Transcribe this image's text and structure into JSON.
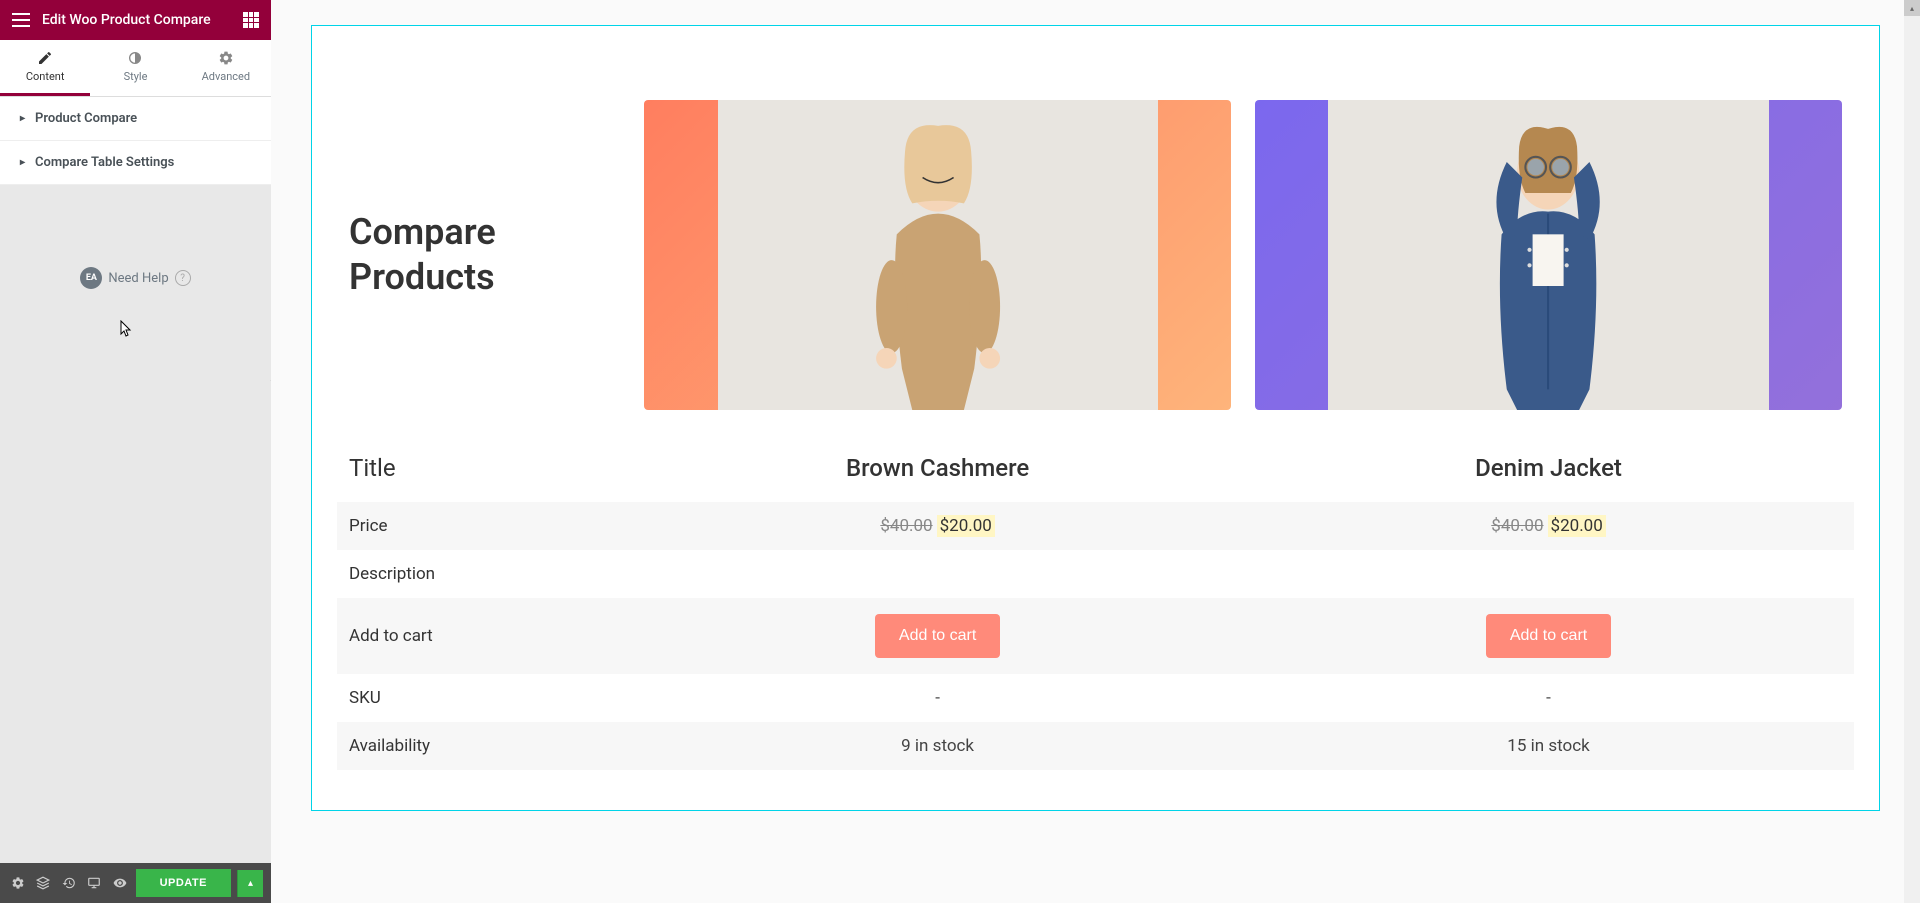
{
  "header": {
    "title": "Edit Woo Product Compare"
  },
  "tabs": {
    "content": "Content",
    "style": "Style",
    "advanced": "Advanced"
  },
  "sections": {
    "product_compare": "Product Compare",
    "compare_table_settings": "Compare Table Settings"
  },
  "help": {
    "badge_text": "EA",
    "label": "Need Help",
    "icon": "?"
  },
  "footer": {
    "update_button": "UPDATE"
  },
  "compare": {
    "heading_line1": "Compare",
    "heading_line2": "Products",
    "rows": {
      "title": "Title",
      "price": "Price",
      "description": "Description",
      "add_to_cart": "Add to cart",
      "sku": "SKU",
      "availability": "Availability"
    },
    "products": [
      {
        "title": "Brown Cashmere",
        "old_price": "$40.00",
        "new_price": "$20.00",
        "description": "",
        "add_to_cart_label": "Add to cart",
        "sku": "-",
        "availability": "9 in stock"
      },
      {
        "title": "Denim Jacket",
        "old_price": "$40.00",
        "new_price": "$20.00",
        "description": "",
        "add_to_cart_label": "Add to cart",
        "sku": "-",
        "availability": "15 in stock"
      }
    ]
  }
}
